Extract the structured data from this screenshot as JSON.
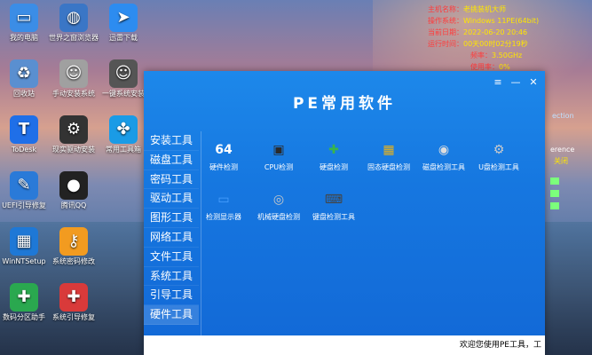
{
  "desktop": {
    "icons": [
      {
        "label": "我的电脑",
        "icon": "computer-icon",
        "color": "#3b8de6"
      },
      {
        "label": "世界之窗浏览器",
        "icon": "globe-icon",
        "color": "#3a76c6"
      },
      {
        "label": "迅雷下载",
        "icon": "bird-icon",
        "color": "#2d8cf0"
      },
      {
        "label": "回收站",
        "icon": "recycle-bin-icon",
        "color": "#5a8fd0"
      },
      {
        "label": "手动安装系统",
        "icon": "ghost-icon",
        "color": "#a0a0a0"
      },
      {
        "label": "一键系统安装",
        "icon": "ghost-icon",
        "color": "#555555"
      },
      {
        "label": "ToDesk",
        "icon": "todesk-icon",
        "color": "#1f6fe8"
      },
      {
        "label": "现实驱动安装",
        "icon": "gear-icon",
        "color": "#333333"
      },
      {
        "label": "常用工具箱",
        "icon": "clover-icon",
        "color": "#1a9be6"
      },
      {
        "label": "UEFI引导修复",
        "icon": "pencil-icon",
        "color": "#2a7ad8"
      },
      {
        "label": "腾讯QQ",
        "icon": "penguin-icon",
        "color": "#222222"
      },
      {
        "label": "WinNTSetup",
        "icon": "windows-icon",
        "color": "#1e78d6"
      },
      {
        "label": "系统密码修改",
        "icon": "key-icon",
        "color": "#f29b20"
      },
      {
        "label": "数码分区助手",
        "icon": "plus-icon",
        "color": "#2aa84f"
      },
      {
        "label": "系统引导修复",
        "icon": "first-aid-icon",
        "color": "#d93a3a"
      }
    ]
  },
  "sysinfo": {
    "rows": [
      {
        "label": "主机名称：",
        "value": "老挑装机大师"
      },
      {
        "label": "操作系统：",
        "value": "Windows 11PE(64bit)"
      },
      {
        "label": "当前日期：",
        "value": "2022-06-20 20:46"
      },
      {
        "label": "运行时间：",
        "value": "00天00时02分19秒"
      }
    ],
    "cpu_label": "频率：",
    "cpu_value": "3.50GHz",
    "usage_label": "使用率：",
    "usage_value": "0%",
    "date_label": "星期一"
  },
  "window": {
    "title": "PE常用软件",
    "menu_label": "≡",
    "min_label": "—",
    "close_label": "✕",
    "sidebar": [
      "安装工具",
      "磁盘工具",
      "密码工具",
      "驱动工具",
      "图形工具",
      "网络工具",
      "文件工具",
      "系统工具",
      "引导工具",
      "硬件工具"
    ],
    "active_index": 9,
    "tools": [
      {
        "label": "硬件检测",
        "glyph": "64",
        "color": "#ffffff"
      },
      {
        "label": "CPU检测",
        "glyph": "▣",
        "color": "#2a2a2a"
      },
      {
        "label": "硬盘检测",
        "glyph": "✚",
        "color": "#39b54a"
      },
      {
        "label": "固态硬盘检测",
        "glyph": "▦",
        "color": "#e8b21a"
      },
      {
        "label": "磁盘检测工具",
        "glyph": "◉",
        "color": "#dddddd"
      },
      {
        "label": "U盘检测工具",
        "glyph": "⚙",
        "color": "#cccccc"
      },
      {
        "label": "检测显示器",
        "glyph": "▭",
        "color": "#4aa0ff"
      },
      {
        "label": "机械硬盘检测",
        "glyph": "◎",
        "color": "#c9c9c9"
      },
      {
        "label": "键盘检测工具",
        "glyph": "⌨",
        "color": "#444444"
      }
    ],
    "status_text": "欢迎您使用PE工具，工"
  },
  "right_strip": {
    "lines": [
      "ection",
      "erence",
      "关闭"
    ]
  }
}
